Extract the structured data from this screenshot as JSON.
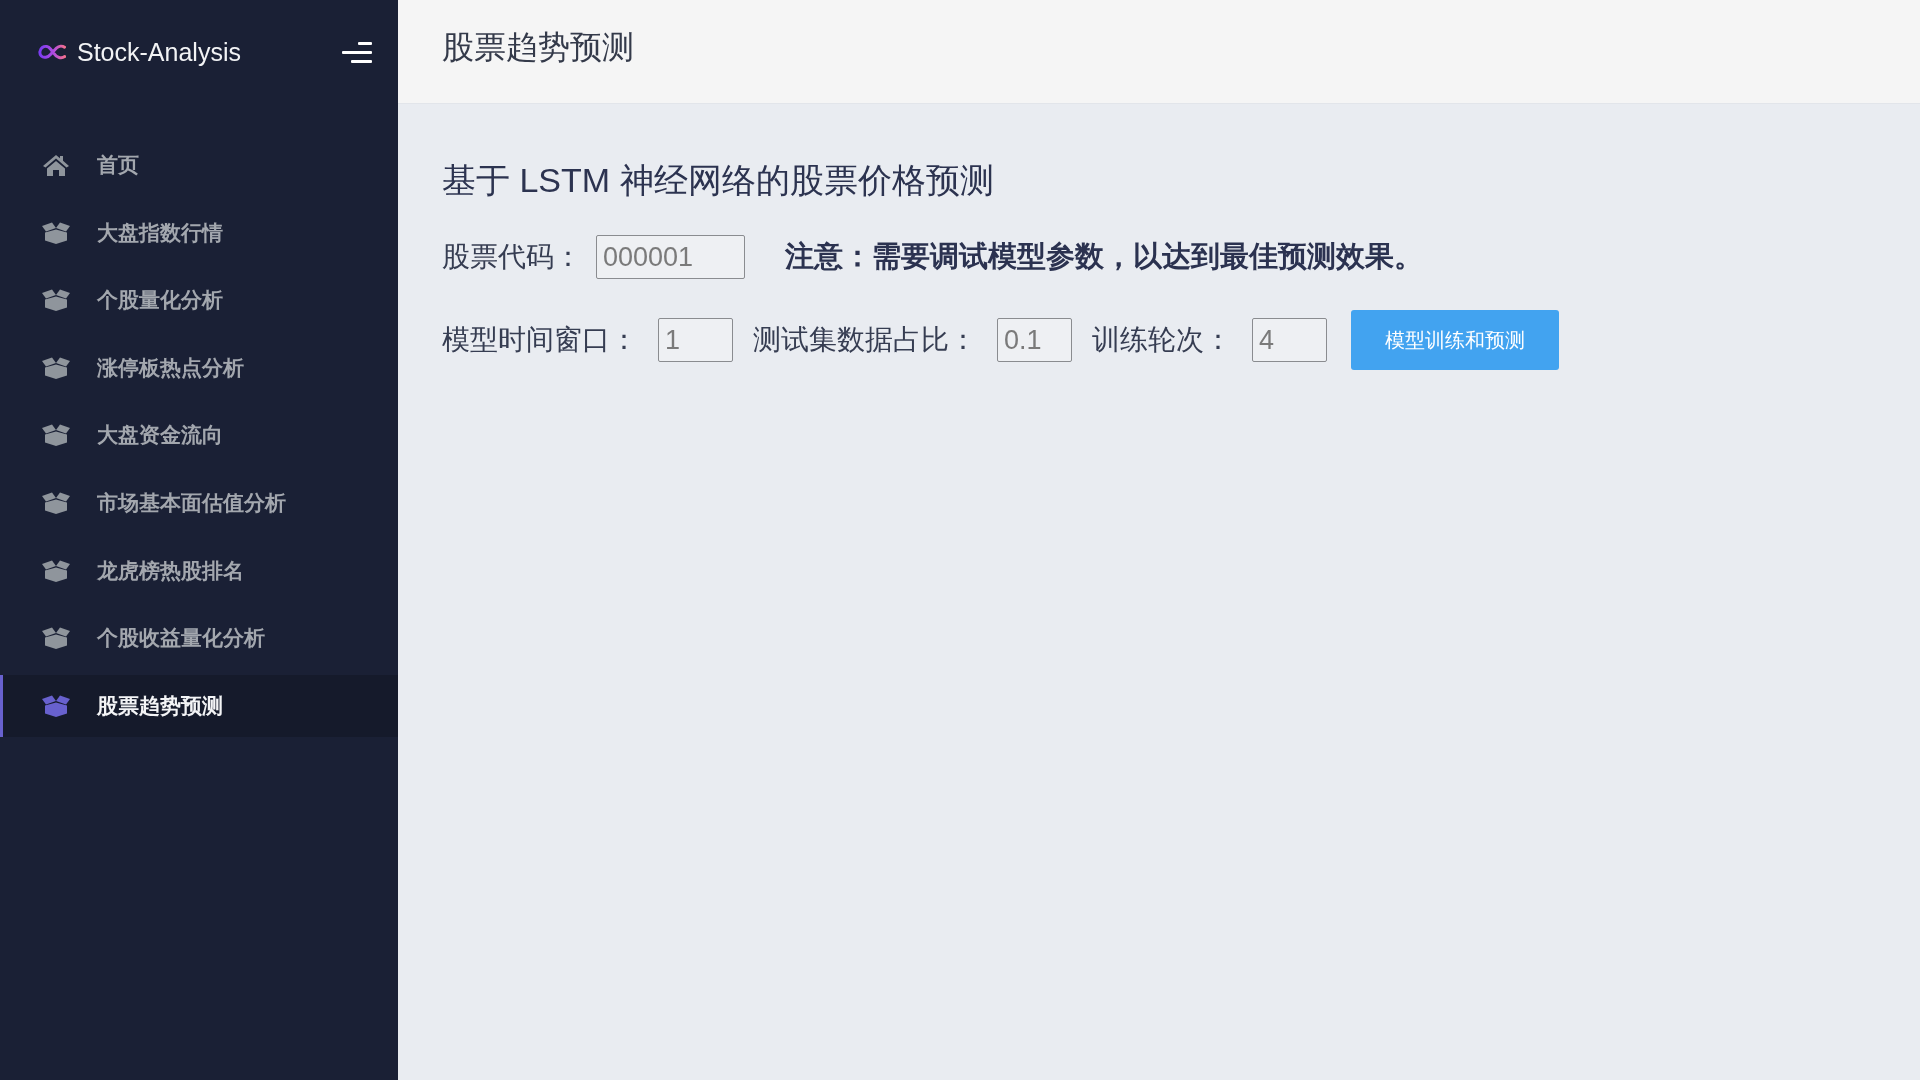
{
  "sidebar": {
    "brand": "Stock-Analysis",
    "items": [
      {
        "label": "首页",
        "kind": "home",
        "selected": false
      },
      {
        "label": "大盘指数行情",
        "kind": "box",
        "selected": false
      },
      {
        "label": "个股量化分析",
        "kind": "box",
        "selected": false
      },
      {
        "label": "涨停板热点分析",
        "kind": "box",
        "selected": false
      },
      {
        "label": "大盘资金流向",
        "kind": "box",
        "selected": false
      },
      {
        "label": "市场基本面估值分析",
        "kind": "box",
        "selected": false
      },
      {
        "label": "龙虎榜热股排名",
        "kind": "box",
        "selected": false
      },
      {
        "label": "个股收益量化分析",
        "kind": "box",
        "selected": false
      },
      {
        "label": "股票趋势预测",
        "kind": "box",
        "selected": true
      }
    ]
  },
  "header": {
    "title": "股票趋势预测"
  },
  "content": {
    "heading": "基于 LSTM 神经网络的股票价格预测",
    "stock_code": {
      "label": "股票代码：",
      "value": "000001"
    },
    "note": "注意：需要调试模型参数，以达到最佳预测效果。",
    "params": [
      {
        "label": "模型时间窗口：",
        "value": "1"
      },
      {
        "label": "测试集数据占比：",
        "value": "0.1"
      },
      {
        "label": "训练轮次：",
        "value": "4"
      }
    ],
    "submit_button": "模型训练和预测"
  }
}
